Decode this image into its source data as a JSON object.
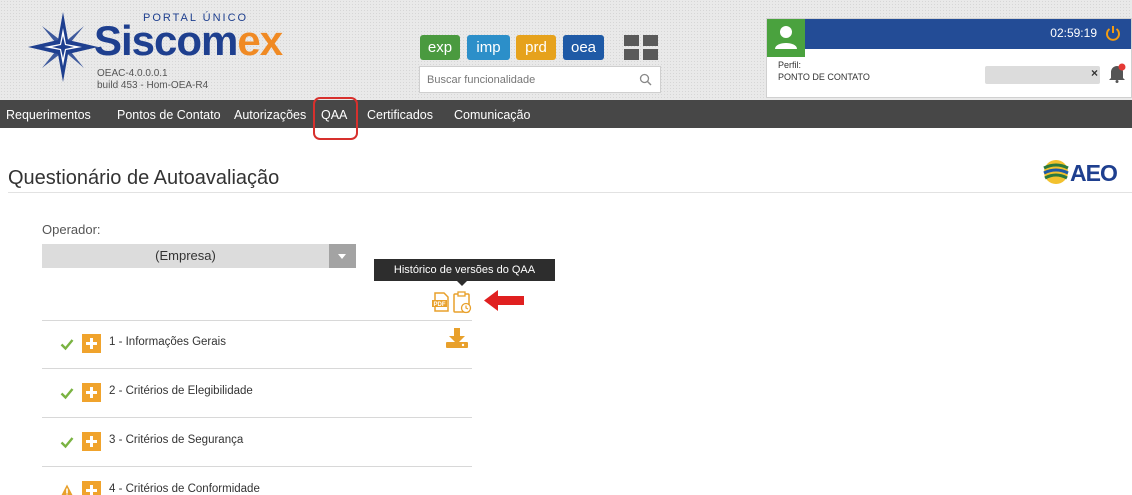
{
  "header": {
    "portal_label": "PORTAL ÚNICO",
    "logo_text_main": "Siscom",
    "logo_text_accent": "ex",
    "version": "OEAC-4.0.0.0.1",
    "build": "build 453 - Hom-OEA-R4",
    "apps": [
      {
        "label": "exp",
        "color": "#4a9a3f"
      },
      {
        "label": "imp",
        "color": "#2c8fc9"
      },
      {
        "label": "prd",
        "color": "#e6a21c"
      },
      {
        "label": "oea",
        "color": "#1f5aa6"
      }
    ],
    "search_placeholder": "Buscar funcionalidade"
  },
  "user": {
    "clock": "02:59:19",
    "perfil_label": "Perfil:",
    "perfil_value": "PONTO DE CONTATO",
    "clear_label": "×"
  },
  "menu": {
    "items": [
      "Requerimentos",
      "Pontos de Contato",
      "Autorizações",
      "QAA",
      "Certificados",
      "Comunicação"
    ]
  },
  "page": {
    "title": "Questionário de Autoavaliação",
    "logo_label": "AEO"
  },
  "operador": {
    "label": "Operador:",
    "value": "(Empresa)"
  },
  "tooltip": "Histórico de versões do QAA",
  "sections": [
    {
      "label": "1 - Informações Gerais",
      "status": "check"
    },
    {
      "label": "2 - Critérios de Elegibilidade",
      "status": "check"
    },
    {
      "label": "3 - Critérios de Segurança",
      "status": "check"
    },
    {
      "label": "4 - Critérios de Conformidade",
      "status": "warning"
    }
  ],
  "colors": {
    "accent_orange": "#f0a32c",
    "check_green": "#7ab342",
    "warning_orange": "#e8a02b",
    "menu_bg": "#474747",
    "user_bar": "#234c96",
    "annotation_red": "#d7302d"
  }
}
